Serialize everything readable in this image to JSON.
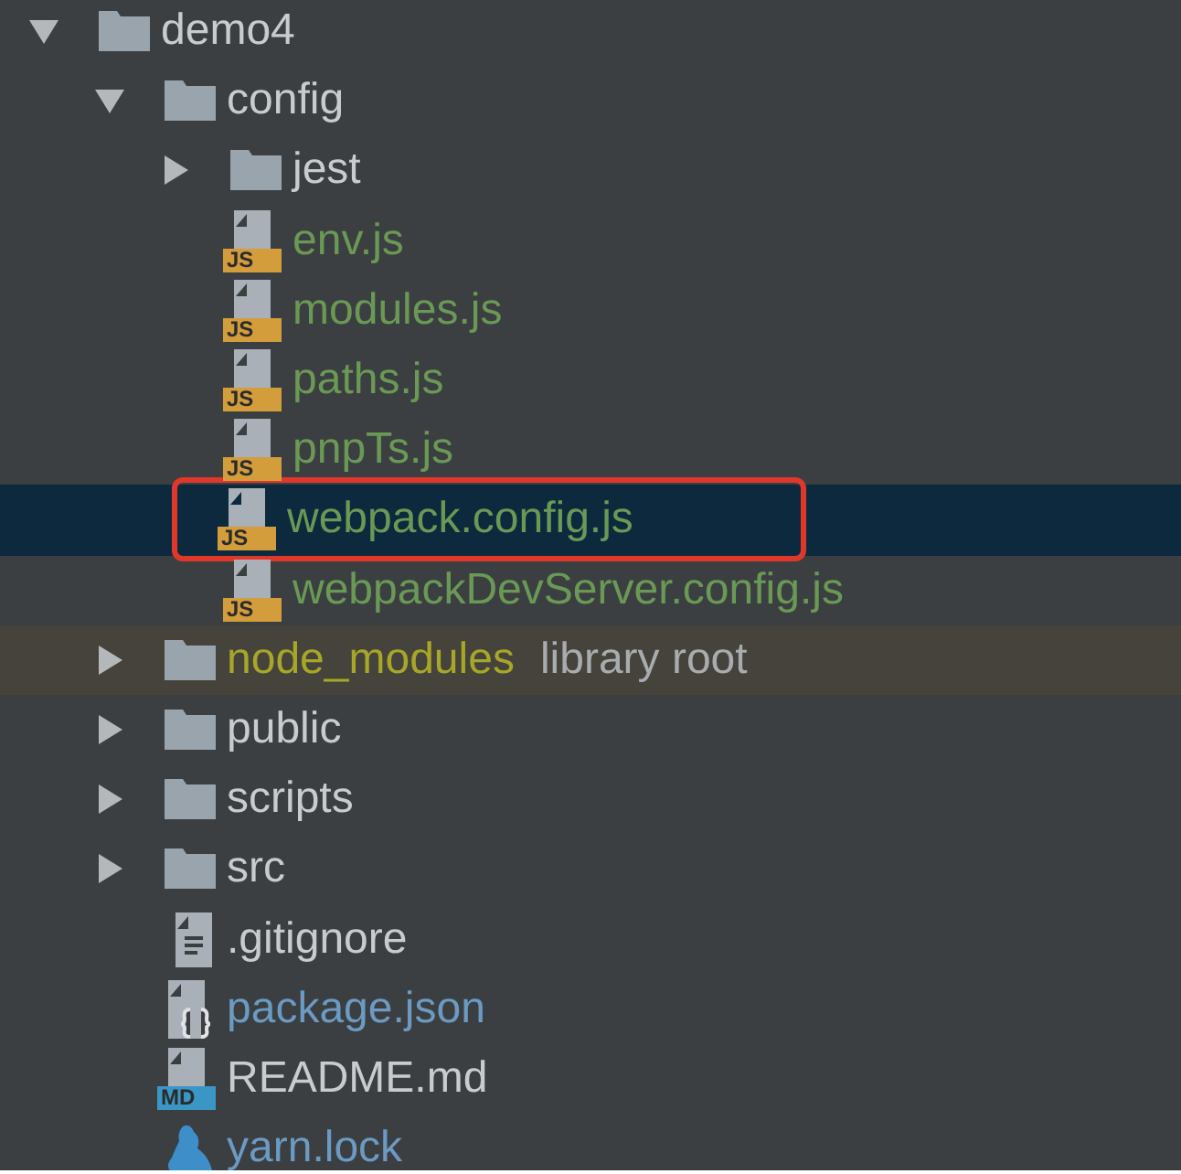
{
  "tree": [
    {
      "kind": "folder",
      "name": "demo4",
      "expanded": true,
      "selected": false,
      "children": [
        {
          "kind": "folder",
          "name": "config",
          "expanded": true,
          "selected": false,
          "children": [
            {
              "kind": "folder",
              "name": "jest",
              "expanded": false,
              "selected": false
            },
            {
              "kind": "js",
              "badge": "JS",
              "name": "env.js",
              "color": "#6a9955",
              "selected": false
            },
            {
              "kind": "js",
              "badge": "JS",
              "name": "modules.js",
              "color": "#6a9955",
              "selected": false
            },
            {
              "kind": "js",
              "badge": "JS",
              "name": "paths.js",
              "color": "#6a9955",
              "selected": false
            },
            {
              "kind": "js",
              "badge": "JS",
              "name": "pnpTs.js",
              "color": "#6a9955",
              "selected": false
            },
            {
              "kind": "js",
              "badge": "JS",
              "name": "webpack.config.js",
              "color": "#6a9955",
              "selected": true,
              "annotated": true
            },
            {
              "kind": "js",
              "badge": "JS",
              "name": "webpackDevServer.config.js",
              "color": "#6a9955",
              "selected": false
            }
          ]
        },
        {
          "kind": "folder",
          "name": "node_modules",
          "color": "#a6a628",
          "note": "library root",
          "excluded": true,
          "expanded": false,
          "selected": false
        },
        {
          "kind": "folder",
          "name": "public",
          "expanded": false,
          "selected": false
        },
        {
          "kind": "folder",
          "name": "scripts",
          "expanded": false,
          "selected": false
        },
        {
          "kind": "folder",
          "name": "src",
          "expanded": false,
          "selected": false
        },
        {
          "kind": "text",
          "name": ".gitignore",
          "selected": false
        },
        {
          "kind": "json",
          "name": "package.json",
          "color": "#6b9ac2",
          "selected": false
        },
        {
          "kind": "md",
          "badge": "MD",
          "name": "README.md",
          "selected": false
        },
        {
          "kind": "yarn",
          "name": "yarn.lock",
          "color": "#6b9ac2",
          "selected": false
        }
      ]
    }
  ]
}
